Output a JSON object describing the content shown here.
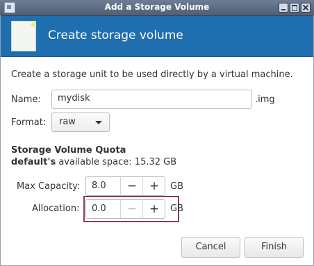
{
  "window": {
    "title": "Add a Storage Volume",
    "controls": [
      "minimize-icon",
      "maximize-icon",
      "close-icon"
    ]
  },
  "header": {
    "title": "Create storage volume",
    "icon": "new-volume-icon",
    "background_color": "#1f6eaf"
  },
  "description": "Create a storage unit to be used directly by a virtual machine.",
  "form": {
    "name_label": "Name:",
    "name_value": "mydisk",
    "name_suffix": ".img",
    "format_label": "Format:",
    "format_value": "raw"
  },
  "quota": {
    "title": "Storage Volume Quota",
    "pool_name": "default's",
    "space_text": " available space: 15.32 GB"
  },
  "capacity": {
    "max_label": "Max Capacity:",
    "max_value": "8.0",
    "max_unit": "GB",
    "alloc_label": "Allocation:",
    "alloc_value": "0.0",
    "alloc_unit": "GB",
    "minus": "−",
    "plus": "+"
  },
  "buttons": {
    "cancel": "Cancel",
    "finish": "Finish"
  },
  "colors": {
    "highlight_border": "#8b3a62"
  }
}
